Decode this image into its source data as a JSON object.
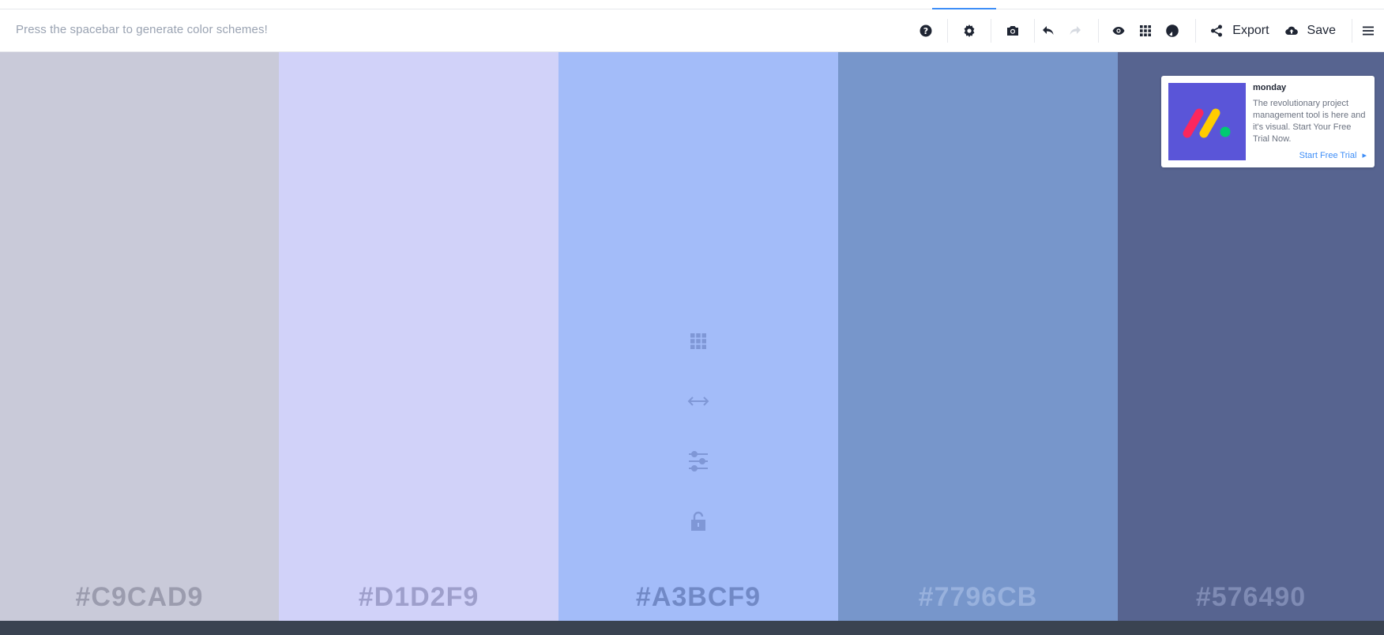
{
  "toolbar": {
    "hint": "Press the spacebar to generate color schemes!",
    "export_label": "Export",
    "save_label": "Save",
    "icons": [
      "help-icon",
      "settings-icon",
      "camera-icon",
      "undo-icon",
      "redo-icon",
      "view-icon",
      "grid-icon",
      "contrast-icon",
      "share-icon",
      "cloud-upload-icon",
      "menu-icon"
    ]
  },
  "palette": [
    {
      "hex": "#C9CAD9",
      "color": "#C9CAD9",
      "text_color": "#9b9cae"
    },
    {
      "hex": "#D1D2F9",
      "color": "#D1D2F9",
      "text_color": "#9e9fcb"
    },
    {
      "hex": "#A3BCF9",
      "color": "#A3BCF9",
      "text_color": "#7189c6"
    },
    {
      "hex": "#7796CB",
      "color": "#7796CB",
      "text_color": "#98b1dd"
    },
    {
      "hex": "#576490",
      "color": "#576490",
      "text_color": "#7f8bb4"
    }
  ],
  "swatch_tools": [
    "grid-icon",
    "drag-icon",
    "adjust-icon",
    "lock-icon"
  ],
  "ad": {
    "title": "monday",
    "body": "The revolutionary project management tool is here and it's visual. Start Your Free Trial Now.",
    "cta": "Start Free Trial",
    "cta_arrow": "▸",
    "image_bg": "#5a55d8"
  },
  "colors": {
    "accent": "#3e8ef7",
    "bottom_bar": "#3a4351"
  }
}
